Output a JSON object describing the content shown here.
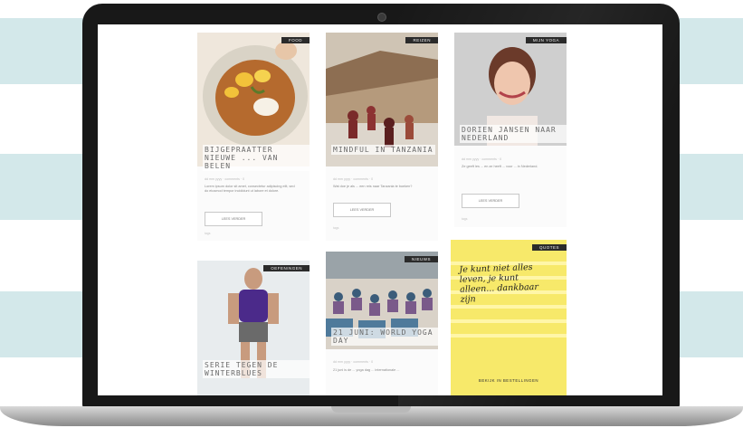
{
  "posts": [
    {
      "category": "Food",
      "title": "Bijgepraatter nieuwe ... van Belen",
      "meta": "dd mm yyyy · comments · 0",
      "excerpt": "Lorem ipsum dolor sit amet, consectetur adipiscing elit, sed do eiusmod tempor incididunt ut labore et dolore.",
      "button": "Lees verder",
      "tags": "tags"
    },
    {
      "category": "Reizen",
      "title": "Mindful in Tanzania",
      "meta": "dd mm yyyy · comments · 0",
      "excerpt": "Wat doe je als ... een reis naar Tanzania te boeken?",
      "button": "Lees verder",
      "tags": "tags"
    },
    {
      "category": "Mijn Yoga",
      "title": "Dorien Jansen naar Nederland",
      "meta": "dd mm yyyy · comments · 0",
      "excerpt": "Ze geeft les ... en ze heeft ... voor ... in Nederland.",
      "button": "Lees verder",
      "tags": "tags"
    },
    {
      "category": "Oefeningen",
      "title": "Serie tegen de winterblues",
      "meta": "",
      "excerpt": "",
      "button": "",
      "tags": ""
    },
    {
      "category": "Nieuws",
      "title": "21 juni: World Yoga Day",
      "meta": "dd mm yyyy · comments · 0",
      "excerpt": "21 juni is de ... yoga dag ... internationale ...",
      "button": "",
      "tags": ""
    },
    {
      "category": "Quotes",
      "quote": "Je kunt niet alles leven, je kunt alleen... dankbaar zijn",
      "button": "Bekijk in Bestellingen"
    }
  ],
  "colors": {
    "stripe": "#d3e8ea",
    "quoteBg": "#f7e96a"
  }
}
